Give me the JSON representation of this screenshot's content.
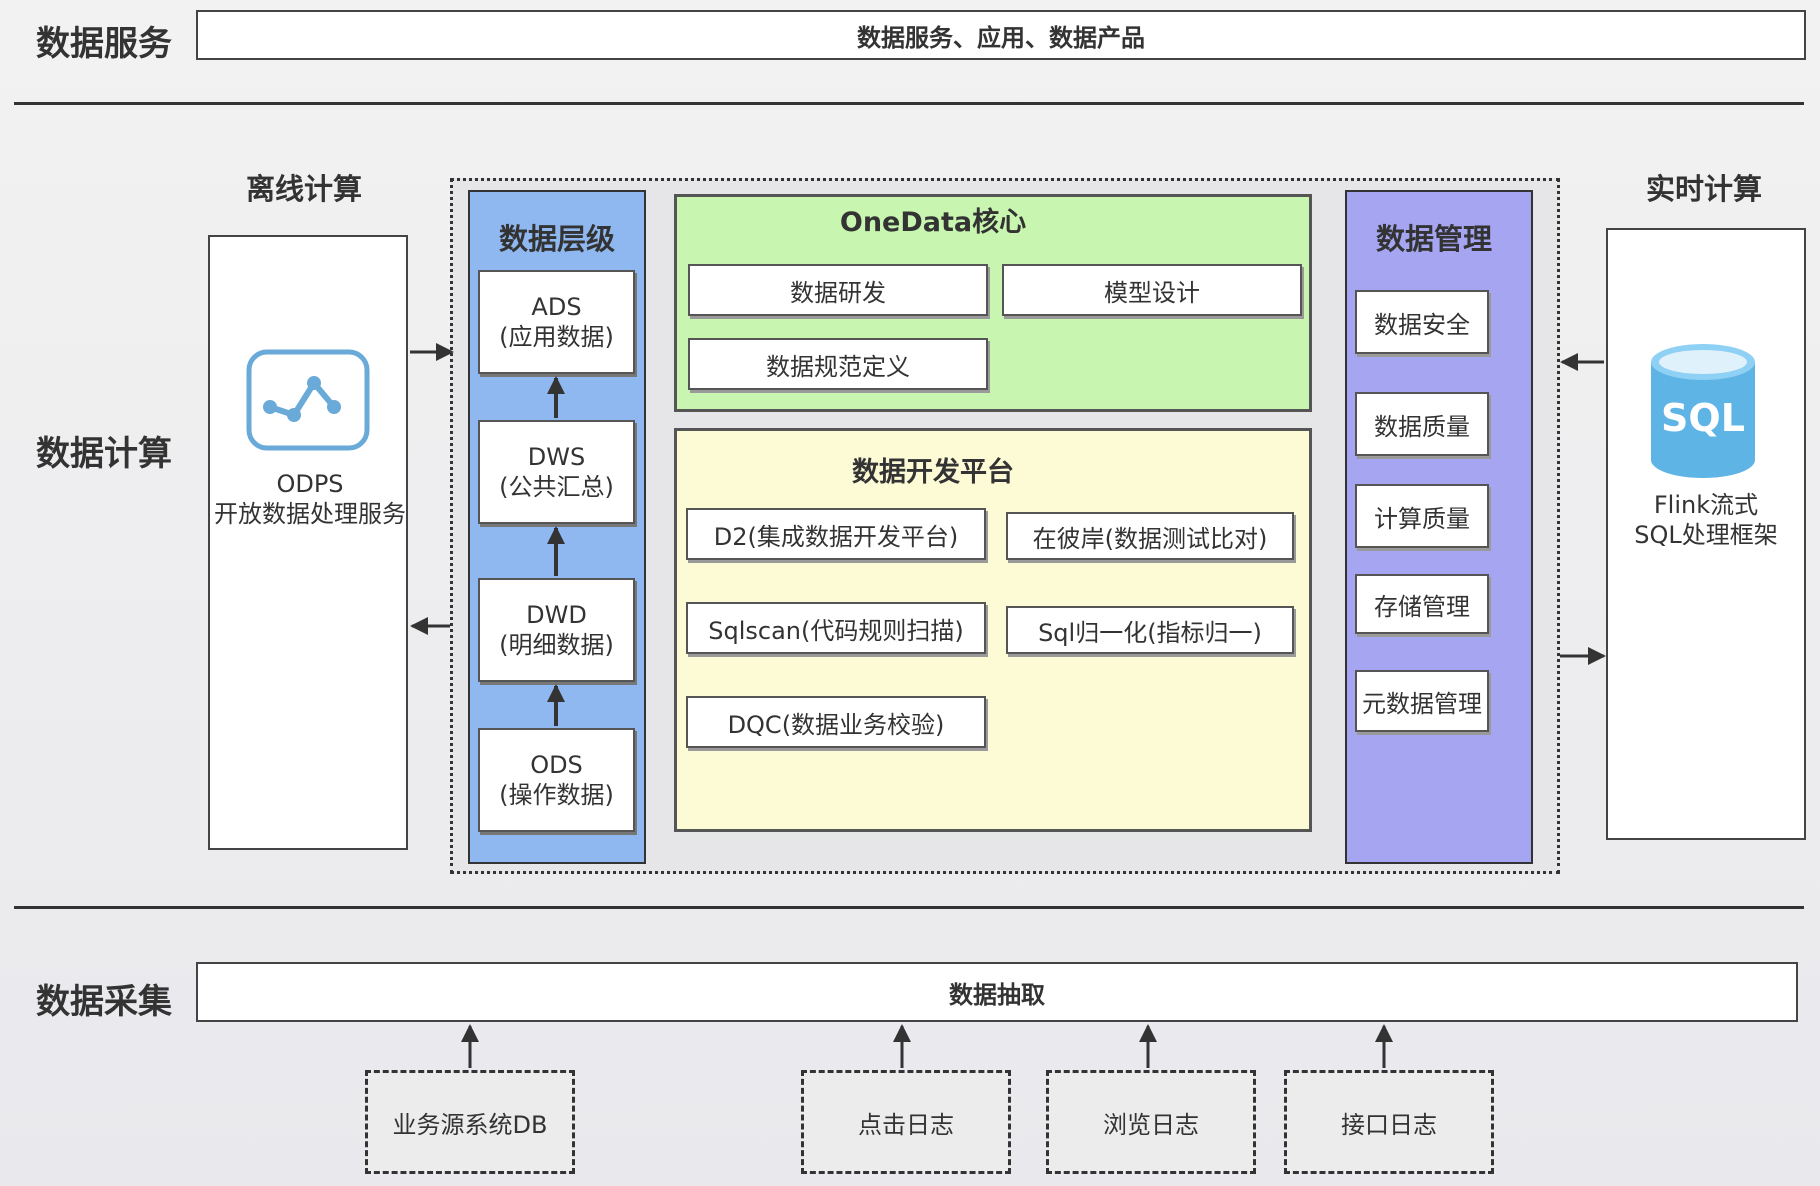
{
  "service": {
    "label": "数据服务",
    "bar": "数据服务、应用、数据产品"
  },
  "compute": {
    "label": "数据计算",
    "offline": {
      "title": "离线计算",
      "name": "ODPS",
      "desc": "开放数据处理服务",
      "icon": "odps-chart-icon"
    },
    "realtime": {
      "title": "实时计算",
      "icon_text": "SQL",
      "name": "Flink流式",
      "desc": "SQL处理框架",
      "icon": "sql-database-icon"
    },
    "layers": {
      "title": "数据层级",
      "items": [
        {
          "code": "ADS",
          "desc": "(应用数据)"
        },
        {
          "code": "DWS",
          "desc": "(公共汇总)"
        },
        {
          "code": "DWD",
          "desc": "(明细数据)"
        },
        {
          "code": "ODS",
          "desc": "(操作数据)"
        }
      ]
    },
    "onedata": {
      "title": "OneData核心",
      "items": [
        "数据研发",
        "模型设计",
        "数据规范定义"
      ]
    },
    "platform": {
      "title": "数据开发平台",
      "items": [
        "D2(集成数据开发平台)",
        "在彼岸(数据测试比对)",
        "Sqlscan(代码规则扫描)",
        "Sql归一化(指标归一)",
        "DQC(数据业务校验)"
      ]
    },
    "management": {
      "title": "数据管理",
      "items": [
        "数据安全",
        "数据质量",
        "计算质量",
        "存储管理",
        "元数据管理"
      ]
    }
  },
  "collect": {
    "label": "数据采集",
    "bar": "数据抽取",
    "sources": [
      "业务源系统DB",
      "点击日志",
      "浏览日志",
      "接口日志"
    ]
  },
  "colors": {
    "layers_bg": "#8fb8f0",
    "onedata_bg": "#c8f5b0",
    "platform_bg": "#fdfad6",
    "management_bg": "#a5a5f2",
    "sql_icon": "#5fb4e6",
    "odps_icon": "#6aaad8"
  }
}
